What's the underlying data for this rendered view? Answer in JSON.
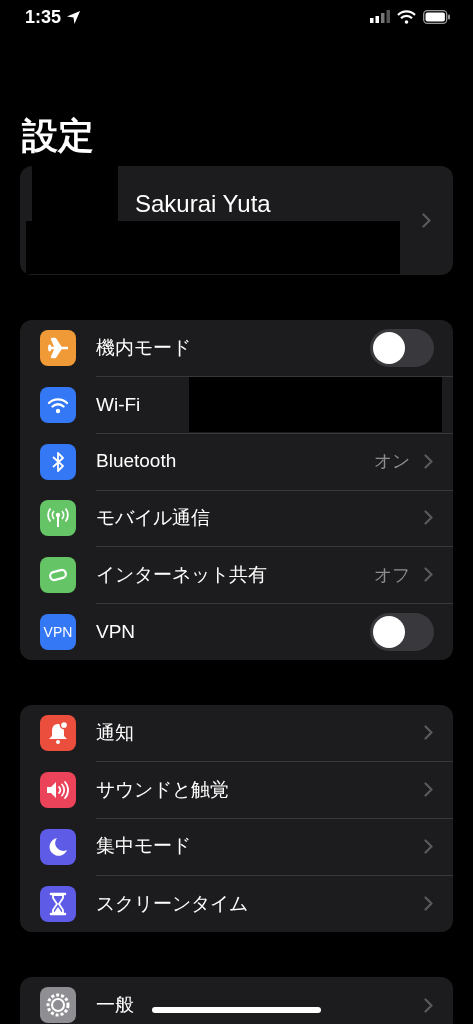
{
  "status_bar": {
    "time": "1:35"
  },
  "title": "設定",
  "profile": {
    "name": "Sakurai Yuta"
  },
  "groups": [
    {
      "rows": [
        {
          "kind": "toggle",
          "label": "機内モード",
          "color": "#f09a37",
          "on": false
        },
        {
          "kind": "redacted",
          "label": "Wi-Fi",
          "color": "#3478f6"
        },
        {
          "kind": "link",
          "label": "Bluetooth",
          "color": "#3478f6",
          "value": "オン"
        },
        {
          "kind": "link",
          "label": "モバイル通信",
          "color": "#65c466"
        },
        {
          "kind": "link",
          "label": "インターネット共有",
          "color": "#65c466",
          "value": "オフ"
        },
        {
          "kind": "toggle",
          "label": "VPN",
          "color": "#3478f6",
          "icon_text": "VPN",
          "on": false
        }
      ]
    },
    {
      "rows": [
        {
          "kind": "link",
          "label": "通知",
          "color": "#eb4e3d"
        },
        {
          "kind": "link",
          "label": "サウンドと触覚",
          "color": "#eb445a"
        },
        {
          "kind": "link",
          "label": "集中モード",
          "color": "#5e5ce6"
        },
        {
          "kind": "link",
          "label": "スクリーンタイム",
          "color": "#5e5ce6"
        }
      ]
    },
    {
      "rows": [
        {
          "kind": "link",
          "label": "一般",
          "color": "#8e8e93"
        }
      ]
    }
  ]
}
